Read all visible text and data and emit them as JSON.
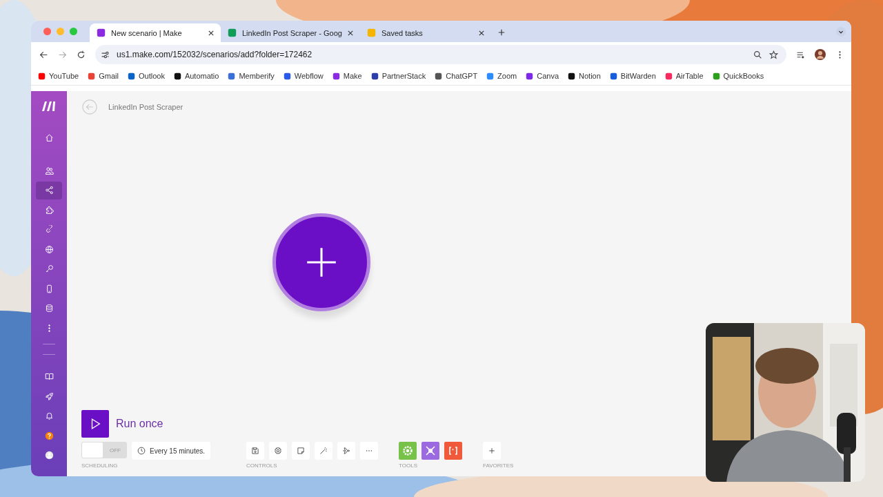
{
  "tabs": [
    {
      "label": "New scenario | Make",
      "selected": true
    },
    {
      "label": "LinkedIn Post Scraper - Goog",
      "selected": false
    },
    {
      "label": "Saved tasks",
      "selected": false
    }
  ],
  "address_bar": {
    "url": "us1.make.com/152032/scenarios/add?folder=172462"
  },
  "bookmarks": [
    "YouTube",
    "Gmail",
    "Outlook",
    "Automatio",
    "Memberify",
    "Webflow",
    "Make",
    "PartnerStack",
    "ChatGPT",
    "Zoom",
    "Canva",
    "Notion",
    "BitWarden",
    "AirTable",
    "QuickBooks"
  ],
  "sidebar": {
    "items": [
      {
        "selected": false
      },
      {
        "selected": false
      },
      {
        "selected": true
      },
      {
        "selected": false
      },
      {
        "selected": false
      },
      {
        "selected": false
      },
      {
        "selected": false
      },
      {
        "selected": false
      },
      {
        "selected": false
      },
      {
        "selected": false
      }
    ],
    "bottom_items": [
      {
        "selected": false
      },
      {
        "selected": false
      },
      {
        "selected": false
      },
      {
        "selected": false
      },
      {
        "selected": false
      }
    ]
  },
  "scenario": {
    "title": "LinkedIn Post Scraper"
  },
  "run_button": {
    "label": "Run once"
  },
  "scheduling": {
    "toggle": {
      "on": false,
      "label": "OFF"
    },
    "interval": "Every 15 minutes.",
    "section": "SCHEDULING"
  },
  "controls": {
    "section": "CONTROLS"
  },
  "tools": {
    "section": "TOOLS"
  },
  "favorites": {
    "section": "FAVORITES"
  }
}
